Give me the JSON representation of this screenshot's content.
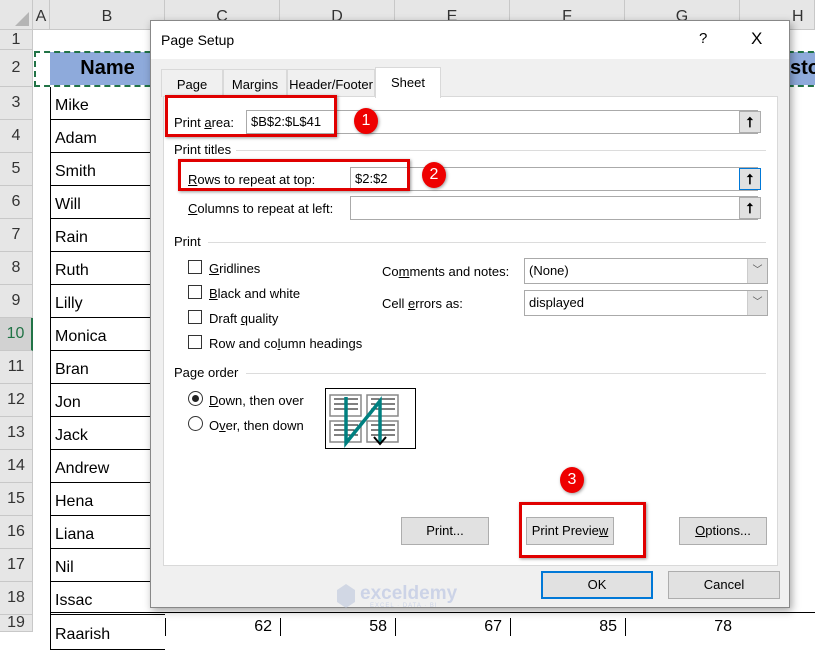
{
  "sheet": {
    "columns": [
      "A",
      "B",
      "C",
      "D",
      "E",
      "F",
      "G",
      "H"
    ],
    "rows": [
      "1",
      "2",
      "3",
      "4",
      "5",
      "6",
      "7",
      "8",
      "9",
      "10",
      "11",
      "12",
      "13",
      "14",
      "15",
      "16",
      "17",
      "18",
      "19"
    ],
    "header_name": "Name",
    "header_right_partial": "sto",
    "names": [
      "Mike",
      "Adam",
      "Smith",
      "Will",
      "Rain",
      "Ruth",
      "Lilly",
      "Monica",
      "Bran",
      "Jon",
      "Jack",
      "Andrew",
      "Hena",
      "Liana",
      "Nil",
      "Issac",
      "Raarish"
    ],
    "last_row_values": [
      "62",
      "58",
      "67",
      "85",
      "78"
    ],
    "header_fill": "#8eaadb",
    "selected_row": "10"
  },
  "dialog": {
    "title": "Page Setup",
    "help": "?",
    "close": "X",
    "tabs": [
      "Page",
      "Margins",
      "Header/Footer",
      "Sheet"
    ],
    "active_tab": "Sheet",
    "print_area_label": "Print area:",
    "print_area_value": "$B$2:$L$41",
    "print_titles_label": "Print titles",
    "rows_repeat_label": "Rows to repeat at top:",
    "rows_repeat_value": "$2:$2",
    "cols_repeat_label": "Columns to repeat at left:",
    "cols_repeat_value": "",
    "print_label": "Print",
    "checkboxes": [
      {
        "label": "Gridlines",
        "checked": false
      },
      {
        "label": "Black and white",
        "checked": false
      },
      {
        "label": "Draft quality",
        "checked": false
      },
      {
        "label": "Row and column headings",
        "checked": false
      }
    ],
    "comments_label": "Comments and notes:",
    "comments_value": "(None)",
    "errors_label": "Cell errors as:",
    "errors_value": "displayed",
    "page_order_label": "Page order",
    "radios": [
      {
        "label": "Down, then over",
        "selected": true
      },
      {
        "label": "Over, then down",
        "selected": false
      }
    ],
    "buttons": {
      "print": "Print...",
      "preview": "Print Preview",
      "options": "Options...",
      "ok": "OK",
      "cancel": "Cancel"
    }
  },
  "annotations": [
    "1",
    "2",
    "3"
  ],
  "watermark": {
    "brand": "exceldemy",
    "tagline": "EXCEL · DATA · BI"
  },
  "colors": {
    "annotation_red": "#e00000",
    "focus_blue": "#0078d7",
    "arrow_teal": "#008080"
  }
}
